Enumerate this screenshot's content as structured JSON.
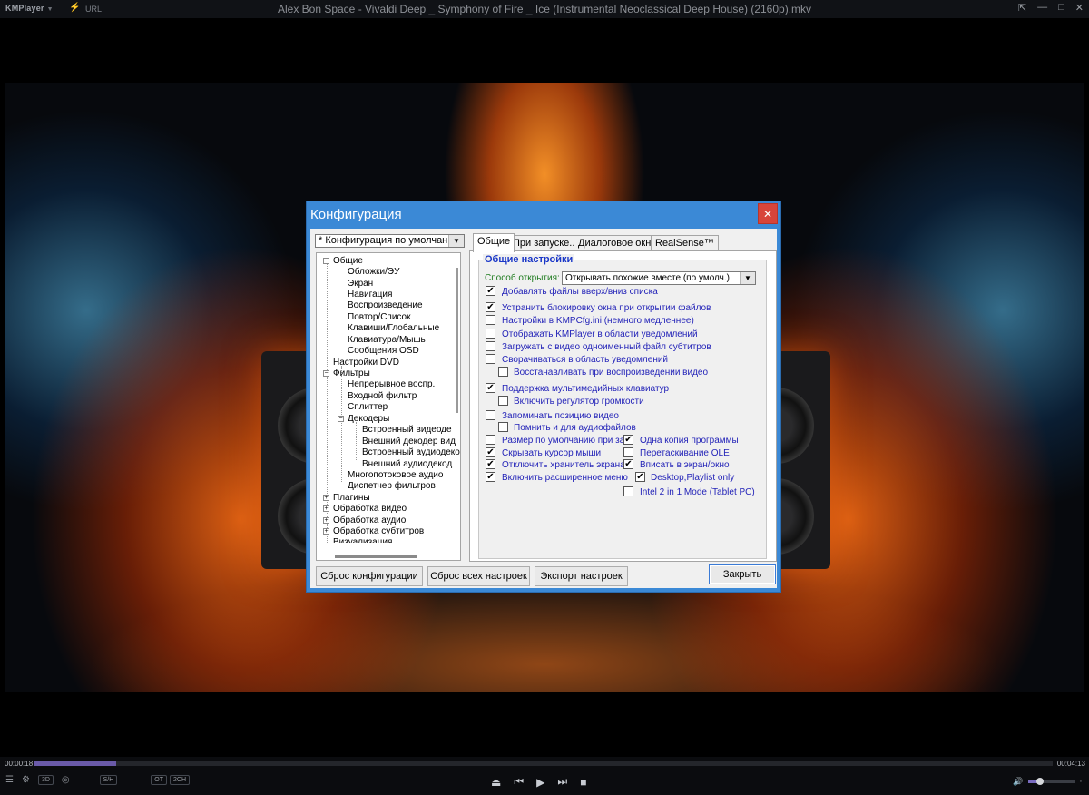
{
  "titlebar": {
    "app": "KMPlayer",
    "url": "URL",
    "title": "Alex Bon Space - Vivaldi Deep _ Symphony of Fire _ Ice (Instrumental Neoclassical Deep House) (2160p).mkv"
  },
  "controls": {
    "time_elapsed": "00:00:18",
    "time_total": "00:04:13",
    "progress": 0.08,
    "volume": 0.25,
    "chip_3d": "3D",
    "chip_s": "S/H",
    "chip_ot": "OT",
    "chip_2ch": "2CH"
  },
  "dialog": {
    "title": "Конфигурация",
    "preset": "* Конфигурация по умолчанию",
    "tree": {
      "general": "Общие",
      "skins": "Обложки/ЭУ",
      "screen": "Экран",
      "navigation": "Навигация",
      "playback": "Воспроизведение",
      "repeat": "Повтор/Список",
      "keys": "Клавиши/Глобальные",
      "keyboard": "Клавиатура/Мышь",
      "osd": "Сообщения OSD",
      "dvd": "Настройки DVD",
      "filters": "Фильтры",
      "continuous": "Непрерывное воспр.",
      "input_filter": "Входной фильтр",
      "splitter": "Сплиттер",
      "decoders": "Декодеры",
      "builtin_video": "Встроенный видеоде",
      "external_video": "Внешний декодер вид",
      "builtin_audio": "Встроенный аудиодеко",
      "external_audio": "Внешний аудиодекод",
      "multistream": "Многопотоковое аудио",
      "filter_manager": "Диспетчер фильтров",
      "plugins": "Плагины",
      "video_processing": "Обработка видео",
      "audio_processing": "Обработка аудио",
      "subtitle_processing": "Обработка субтитров",
      "visualization": "Визуализация"
    },
    "tabs": [
      "Общие",
      "При запуске...",
      "Диалоговое окно",
      "RealSense™"
    ],
    "group_title": "Общие настройки",
    "open_mode_label": "Способ открытия:",
    "open_mode_value": "Открывать похожие вместе (по умолч.)",
    "options": {
      "add_top_bottom": "Добавлять файлы вверх/вниз списка",
      "unlock_window": "Устранить блокировку окна при открытии файлов",
      "kmpcfg": "Настройки в KMPCfg.ini (немного медленнее)",
      "tray_show": "Отображать KMPlayer в области уведомлений",
      "load_subs": "Загружать с видео одноименный файл субтитров",
      "minimize_tray": "Сворачиваться в область уведомлений",
      "restore_on_play": "Восстанавливать при воспроизведении видео",
      "multimedia_kbd": "Поддержка мультимедийных клавиатур",
      "volume_ctrl": "Включить регулятор громкости",
      "remember_pos": "Запоминать позицию видео",
      "remember_audio": "Помнить и для аудиофайлов",
      "default_size": "Размер по умолчанию при зап",
      "hide_cursor": "Скрывать курсор мыши",
      "disable_saver": "Отключить хранитель экрана",
      "extended_menu": "Включить расширенное меню",
      "single_instance": "Одна копия программы",
      "ole_drag": "Перетаскивание OLE",
      "fit_screen": "Вписать в экран/окно",
      "desktop_playlist": "Desktop,Playlist only",
      "intel_2in1": "Intel 2 in 1 Mode (Tablet PC)"
    },
    "buttons": {
      "reset_config": "Сброс конфигурации",
      "reset_all": "Сброс всех настроек",
      "export": "Экспорт настроек",
      "close": "Закрыть"
    }
  }
}
